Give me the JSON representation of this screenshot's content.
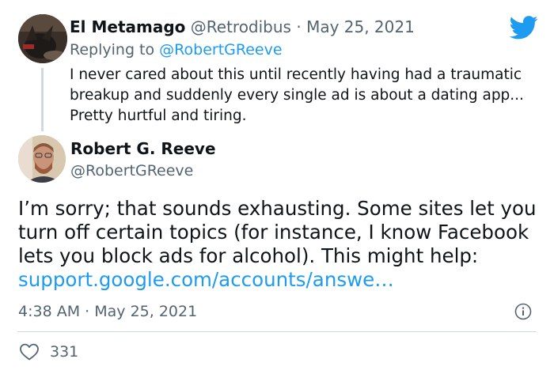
{
  "reply": {
    "author_name": "El Metamago",
    "author_handle": "@Retrodibus",
    "separator": "·",
    "date": "May 25, 2021",
    "replying_to_label": "Replying to",
    "replying_to_handle": "@RobertGReeve",
    "text": "I never cared about this until recently having had a traumatic breakup and suddenly every single ad is about a dating app... Pretty hurtful and tiring."
  },
  "tweet": {
    "author_name": "Robert G. Reeve",
    "author_handle": "@RobertGReeve",
    "text": "I’m sorry; that sounds exhausting. Some sites let you turn off certain topics (for instance, I know Facebook lets you block ads for alcohol). This might help: ",
    "link_text": "support.google.com/accounts/answe…",
    "time": "4:38 AM",
    "separator": "·",
    "date": "May 25, 2021",
    "like_count": "331"
  },
  "colors": {
    "accent": "#1d9bf0",
    "muted": "#536471",
    "text": "#0f1419",
    "line": "#cfd9de"
  },
  "icons": [
    "twitter-bird-icon",
    "info-icon",
    "heart-icon"
  ]
}
